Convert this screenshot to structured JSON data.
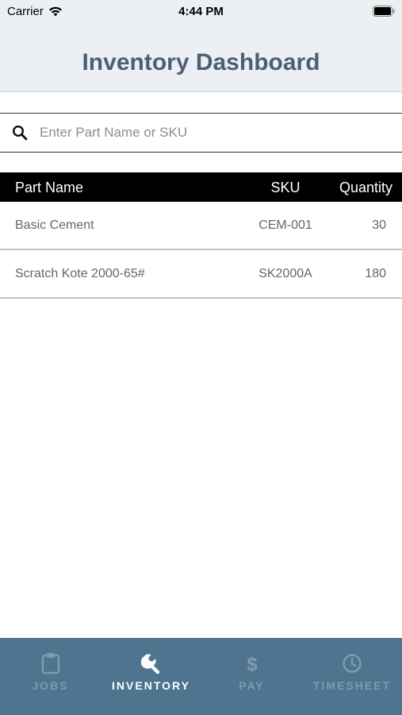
{
  "status_bar": {
    "carrier": "Carrier",
    "time": "4:44 PM",
    "icons": [
      "wifi-icon",
      "battery-icon"
    ]
  },
  "header": {
    "title": "Inventory Dashboard"
  },
  "search": {
    "placeholder": "Enter Part Name or SKU",
    "value": "",
    "icon": "search-icon"
  },
  "table": {
    "columns": [
      "Part Name",
      "SKU",
      "Quantity"
    ],
    "rows": [
      {
        "name": "Basic Cement",
        "sku": "CEM-001",
        "quantity": "30"
      },
      {
        "name": "Scratch Kote 2000-65#",
        "sku": "SK2000A",
        "quantity": "180"
      }
    ]
  },
  "tabbar": {
    "tabs": [
      {
        "label": "JOBS",
        "icon": "clipboard-icon",
        "active": false
      },
      {
        "label": "INVENTORY",
        "icon": "wrench-icon",
        "active": true
      },
      {
        "label": "PAY",
        "icon": "dollar-icon",
        "active": false
      },
      {
        "label": "TIMESHEET",
        "icon": "clock-icon",
        "active": false
      }
    ]
  },
  "colors": {
    "header_bg": "#edf0f2",
    "title": "#4b5f76",
    "tabbar_bg": "#4e7490",
    "tab_inactive": "#7f9bb0",
    "tab_active": "#ffffff"
  }
}
